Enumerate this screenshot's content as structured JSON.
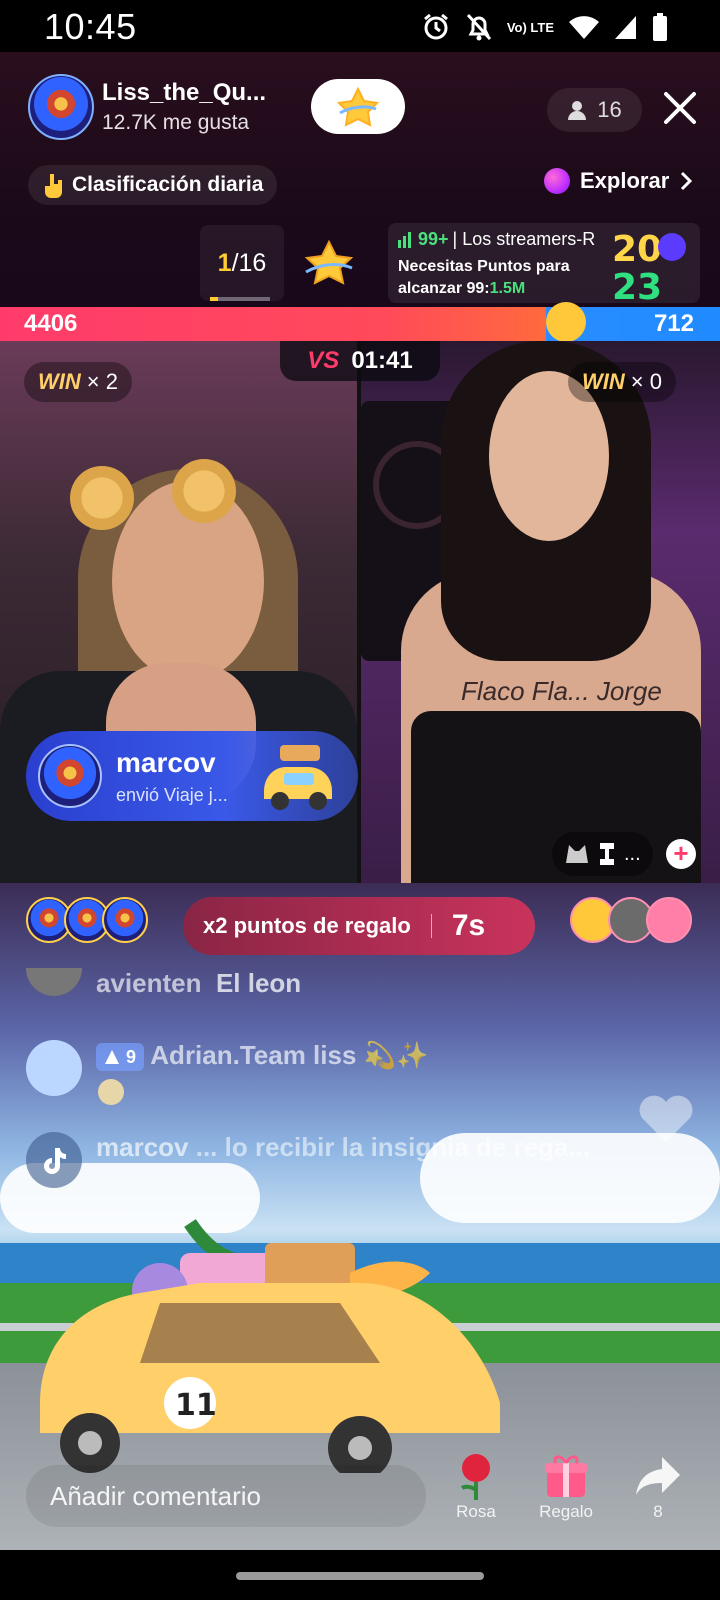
{
  "status_bar": {
    "time": "10:45",
    "network_label": "Vo) LTE",
    "icons": [
      "alarm-icon",
      "bell-off-icon",
      "volte-icon",
      "wifi-icon",
      "signal-icon",
      "battery-icon"
    ]
  },
  "header": {
    "host_name": "Liss_the_Qu...",
    "host_likes": "12.7K me gusta",
    "viewer_count": "16",
    "daily_rank_label": "Clasificación diaria",
    "explore_label": "Explorar"
  },
  "battle": {
    "round_current": "1",
    "round_total": "/16",
    "event_count": "99+",
    "event_title": "| Los streamers-R",
    "event_line": "Necesitas Puntos para alcanzar 99:",
    "event_points": "1.5M",
    "event_badge_lines": [
      "20",
      "23"
    ],
    "score_left": "4406",
    "score_right": "712",
    "score_left_share": 0.86,
    "timer": "01:41",
    "vs_label": "VS",
    "win_left_label": "WIN",
    "win_left_count": "× 2",
    "win_right_label": "WIN",
    "win_right_count": "× 0",
    "right_tools_label": "...",
    "body_writing": "Flaco Fla... Jorge"
  },
  "gift_notice": {
    "sender": "marcov",
    "action": "envió Viaje j..."
  },
  "bonus": {
    "label": "x2 puntos de regalo",
    "seconds": "7s"
  },
  "chat": [
    {
      "user": "avienten",
      "text": "El leon"
    },
    {
      "level": "9",
      "user": "Adrian.Team liss 💫✨",
      "text": ""
    },
    {
      "user": "marcov",
      "text": "... lo recibir la insignia de rega..."
    }
  ],
  "bottom": {
    "comment_placeholder": "Añadir comentario",
    "rose_label": "Rosa",
    "gift_label": "Regalo",
    "share_count": "8"
  },
  "colors": {
    "score_red": "#ff3b6b",
    "score_blue": "#1f8bff",
    "accent_green": "#49e07d",
    "accent_gold": "#ffcc33"
  }
}
